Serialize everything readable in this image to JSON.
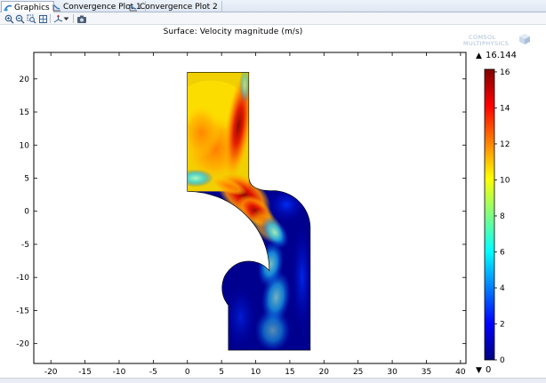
{
  "tabs": [
    {
      "label": "Graphics",
      "icon": "graphics-icon",
      "active": true
    },
    {
      "label": "Convergence Plot 1",
      "icon": "convergence-plot-icon",
      "active": false
    },
    {
      "label": "Convergence Plot 2",
      "icon": "convergence-plot-icon",
      "active": false
    }
  ],
  "toolbar": {
    "buttons": [
      "zoom-in-icon",
      "zoom-out-icon",
      "zoom-box-icon",
      "zoom-extents-icon",
      "axis-orientation-icon",
      "dropdown-arrow-icon",
      "camera-icon"
    ]
  },
  "plot": {
    "title": "Surface: Velocity magnitude (m/s)",
    "logo_line1": "COMSOL",
    "logo_line2": "MULTIPHYSICS",
    "xaxis": {
      "min": -22.5,
      "max": 40.8,
      "ticks": [
        "-20",
        "-15",
        "-10",
        "-5",
        "0",
        "5",
        "10",
        "15",
        "20",
        "25",
        "30",
        "35",
        "40"
      ]
    },
    "yaxis": {
      "min": -23,
      "max": 24,
      "ticks": [
        "20",
        "15",
        "10",
        "5",
        "0",
        "-5",
        "-10",
        "-15",
        "-20"
      ]
    },
    "colorbar": {
      "max_label": "16.144",
      "min_label": "0",
      "max_marker": "▲",
      "min_marker": "▼",
      "ticks": [
        "16",
        "14",
        "12",
        "10",
        "8",
        "6",
        "4",
        "2",
        "0"
      ],
      "colors": [
        "#00007f",
        "#0000ff",
        "#007fff",
        "#00ffff",
        "#7fff7f",
        "#ffff00",
        "#ff7f00",
        "#ff0000",
        "#7f0000"
      ]
    }
  }
}
